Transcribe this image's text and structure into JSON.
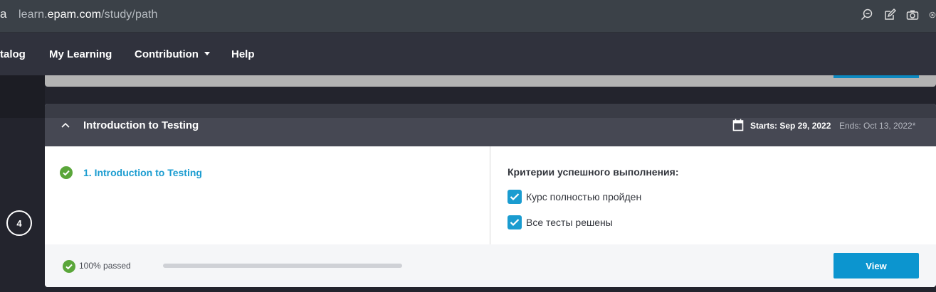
{
  "browser": {
    "url_prefix": "learn.",
    "url_domain": "epam.com",
    "url_path": "/study/path",
    "left_glyph": "a",
    "icons": [
      "zoom-out-icon",
      "edit-icon",
      "camera-icon",
      "close-circle-icon"
    ]
  },
  "nav": {
    "catalog": "talog",
    "my_learning": "My Learning",
    "contribution": "Contribution",
    "help": "Help"
  },
  "step": {
    "number": "4"
  },
  "card": {
    "title": "Introduction to Testing",
    "starts": "Starts: Sep 29, 2022",
    "ends": "Ends: Oct 13, 2022*",
    "lesson": "1. Introduction to Testing",
    "criteria_title": "Критерии успешного выполнения:",
    "criteria": [
      {
        "label": "Курс полностью пройден",
        "checked": true
      },
      {
        "label": "Все тесты решены",
        "checked": true
      }
    ],
    "passed_label": "100% passed",
    "progress_percent": 100,
    "view_label": "View"
  },
  "colors": {
    "accent": "#0c95cf",
    "link": "#1a9cd0",
    "success": "#5aa63a"
  }
}
